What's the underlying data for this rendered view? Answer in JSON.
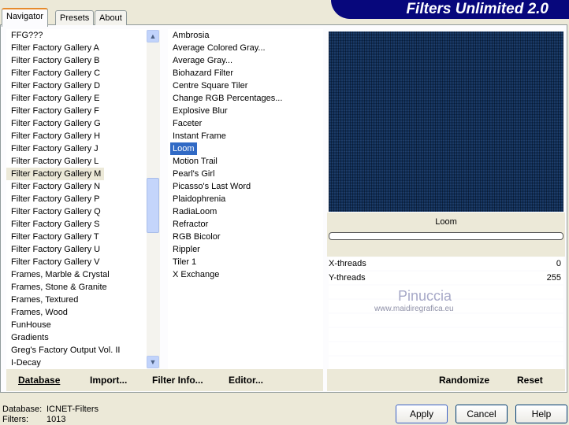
{
  "tabs": [
    "Navigator",
    "Presets",
    "About"
  ],
  "title": "Filters Unlimited 2.0",
  "categories": [
    "FFG???",
    "Filter Factory Gallery A",
    "Filter Factory Gallery B",
    "Filter Factory Gallery C",
    "Filter Factory Gallery D",
    "Filter Factory Gallery E",
    "Filter Factory Gallery F",
    "Filter Factory Gallery G",
    "Filter Factory Gallery H",
    "Filter Factory Gallery J",
    "Filter Factory Gallery L",
    "Filter Factory Gallery M",
    "Filter Factory Gallery N",
    "Filter Factory Gallery P",
    "Filter Factory Gallery Q",
    "Filter Factory Gallery S",
    "Filter Factory Gallery T",
    "Filter Factory Gallery U",
    "Filter Factory Gallery V",
    "Frames, Marble & Crystal",
    "Frames, Stone & Granite",
    "Frames, Textured",
    "Frames, Wood",
    "FunHouse",
    "Gradients",
    "Greg's Factory Output Vol. II",
    "I-Decay"
  ],
  "filters": [
    "Ambrosia",
    "Average Colored Gray...",
    "Average Gray...",
    "Biohazard Filter",
    "Centre Square Tiler",
    "Change RGB Percentages...",
    "Explosive Blur",
    "Faceter",
    "Instant Frame",
    "Loom",
    "Motion Trail",
    "Pearl's Girl",
    "Picasso's Last Word",
    "Plaidophrenia",
    "RadiaLoom",
    "Refractor",
    "RGB Bicolor",
    "Rippler",
    "Tiler 1",
    "X Exchange"
  ],
  "selected_category": "Filter Factory Gallery M",
  "selected_filter": "Loom",
  "preview_label": "Loom",
  "params": [
    {
      "name": "X-threads",
      "value": "0"
    },
    {
      "name": "Y-threads",
      "value": "255"
    }
  ],
  "watermark": {
    "name": "Pinuccia",
    "url": "www.maidiregrafica.eu"
  },
  "bottom_left": [
    "Database",
    "Import...",
    "Filter Info...",
    "Editor..."
  ],
  "bottom_right": [
    "Randomize",
    "Reset"
  ],
  "status": {
    "db_label": "Database:",
    "db_value": "ICNET-Filters",
    "filters_label": "Filters:",
    "filters_value": "1013"
  },
  "buttons": {
    "apply": "Apply",
    "cancel": "Cancel",
    "help": "Help"
  }
}
